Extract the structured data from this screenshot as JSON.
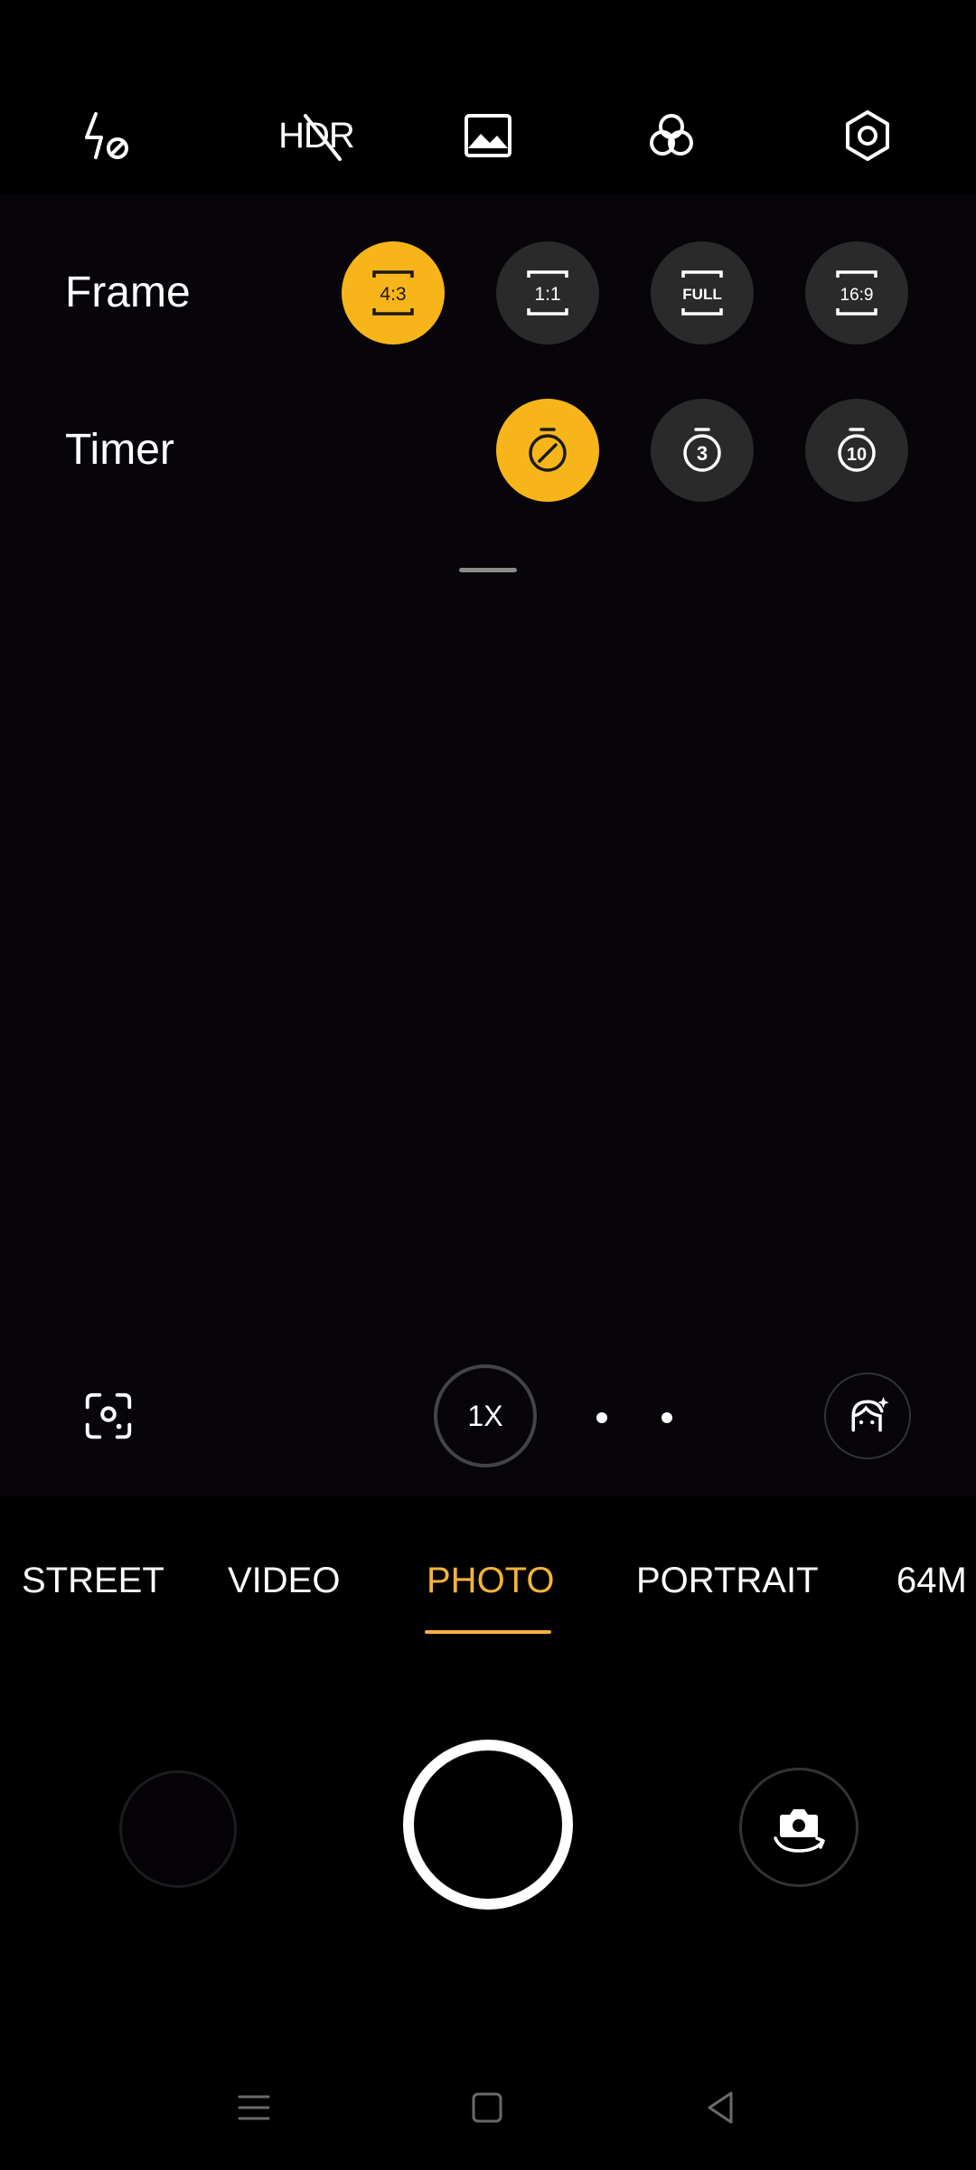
{
  "status": {
    "privacy_dot_color": "#2ecc71"
  },
  "toolbar": {
    "flash_icon": "flash-auto-off-icon",
    "hdr_label": "HDR",
    "hdr_icon": "hdr-off-icon",
    "gallery_icon": "gallery-icon",
    "filter_icon": "filter-icon",
    "settings_icon": "settings-icon"
  },
  "options": {
    "frame": {
      "label": "Frame",
      "choices": [
        {
          "label": "4:3",
          "selected": true
        },
        {
          "label": "1:1",
          "selected": false
        },
        {
          "label": "FULL",
          "selected": false
        },
        {
          "label": "16:9",
          "selected": false
        }
      ]
    },
    "timer": {
      "label": "Timer",
      "choices": [
        {
          "label": "off",
          "icon": "timer-off-icon",
          "selected": true
        },
        {
          "label": "3",
          "icon": "timer-3-icon",
          "selected": false
        },
        {
          "label": "10",
          "icon": "timer-10-icon",
          "selected": false
        }
      ]
    }
  },
  "viewfinder": {
    "zoom_label": "1X",
    "lens_icon": "focus-lens-icon",
    "beauty_icon": "beauty-face-icon"
  },
  "modes": {
    "items": [
      "STREET",
      "VIDEO",
      "PHOTO",
      "PORTRAIT",
      "64M"
    ],
    "active": "PHOTO"
  },
  "colors": {
    "accent": "#f8b51a",
    "active_mode": "#f5b33b",
    "button_bg": "#2a2a2a"
  },
  "nav": {
    "menu_icon": "menu-icon",
    "home_icon": "home-icon",
    "back_icon": "back-icon"
  }
}
